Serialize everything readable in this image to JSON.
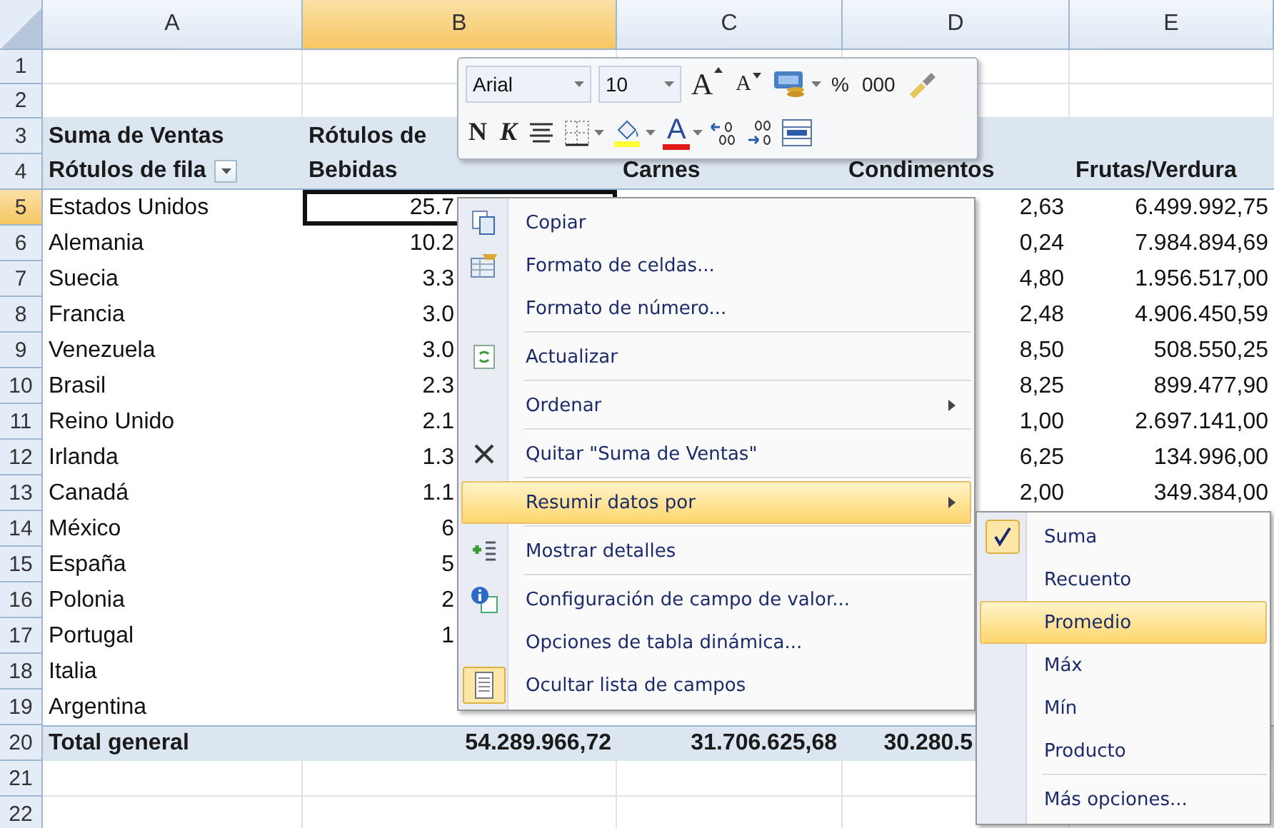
{
  "columns": [
    {
      "label": "A",
      "selected": false
    },
    {
      "label": "B",
      "selected": true
    },
    {
      "label": "C",
      "selected": false
    },
    {
      "label": "D",
      "selected": false
    },
    {
      "label": "E",
      "selected": false
    }
  ],
  "rows": [
    {
      "number": "1",
      "kind": "blank",
      "selected": false
    },
    {
      "number": "2",
      "kind": "blank",
      "selected": false
    },
    {
      "number": "3",
      "kind": "title",
      "selected": false,
      "a": "Suma de Ventas",
      "b": "Rótulos de"
    },
    {
      "number": "4",
      "kind": "labels",
      "selected": false,
      "a": "Rótulos de fila",
      "b": "Bebidas",
      "c": "Carnes",
      "d": "Condimentos",
      "e": "Frutas/Verdura"
    },
    {
      "number": "5",
      "kind": "data",
      "selected": true,
      "a": "Estados Unidos",
      "b": "25.7",
      "d": "2,63",
      "e": "6.499.992,75"
    },
    {
      "number": "6",
      "kind": "data",
      "selected": false,
      "a": "Alemania",
      "b": "10.2",
      "d": "0,24",
      "e": "7.984.894,69"
    },
    {
      "number": "7",
      "kind": "data",
      "selected": false,
      "a": "Suecia",
      "b": "3.3",
      "d": "4,80",
      "e": "1.956.517,00"
    },
    {
      "number": "8",
      "kind": "data",
      "selected": false,
      "a": "Francia",
      "b": "3.0",
      "d": "2,48",
      "e": "4.906.450,59"
    },
    {
      "number": "9",
      "kind": "data",
      "selected": false,
      "a": "Venezuela",
      "b": "3.0",
      "d": "8,50",
      "e": "508.550,25"
    },
    {
      "number": "10",
      "kind": "data",
      "selected": false,
      "a": "Brasil",
      "b": "2.3",
      "d": "8,25",
      "e": "899.477,90"
    },
    {
      "number": "11",
      "kind": "data",
      "selected": false,
      "a": "Reino Unido",
      "b": "2.1",
      "d": "1,00",
      "e": "2.697.141,00"
    },
    {
      "number": "12",
      "kind": "data",
      "selected": false,
      "a": "Irlanda",
      "b": "1.3",
      "d": "6,25",
      "e": "134.996,00"
    },
    {
      "number": "13",
      "kind": "data",
      "selected": false,
      "a": "Canadá",
      "b": "1.1",
      "d": "2,00",
      "e": "349.384,00"
    },
    {
      "number": "14",
      "kind": "data",
      "selected": false,
      "a": "México",
      "b": "6"
    },
    {
      "number": "15",
      "kind": "data",
      "selected": false,
      "a": "España",
      "b": "5"
    },
    {
      "number": "16",
      "kind": "data",
      "selected": false,
      "a": "Polonia",
      "b": "2"
    },
    {
      "number": "17",
      "kind": "data",
      "selected": false,
      "a": "Portugal",
      "b": "1"
    },
    {
      "number": "18",
      "kind": "data",
      "selected": false,
      "a": "Italia"
    },
    {
      "number": "19",
      "kind": "data",
      "selected": false,
      "a": "Argentina"
    },
    {
      "number": "20",
      "kind": "total",
      "selected": false,
      "a": "Total general",
      "b": "54.289.966,72",
      "c": "31.706.625,68",
      "d": "30.280.5"
    },
    {
      "number": "21",
      "kind": "blank",
      "selected": false
    },
    {
      "number": "22",
      "kind": "blank",
      "selected": false
    }
  ],
  "mini_toolbar": {
    "font": "Arial",
    "size": "10",
    "row1": [
      {
        "kind": "grow",
        "label": "A"
      },
      {
        "kind": "shrink",
        "label": "A"
      },
      {
        "kind": "accounting"
      },
      {
        "kind": "text",
        "label": "%"
      },
      {
        "kind": "text",
        "label": "000"
      },
      {
        "kind": "painter"
      }
    ],
    "row2": [
      {
        "kind": "bold",
        "label": "N"
      },
      {
        "kind": "italic",
        "label": "K"
      },
      {
        "kind": "center"
      },
      {
        "kind": "borders"
      },
      {
        "kind": "fill"
      },
      {
        "kind": "fontcolor",
        "label": "A"
      },
      {
        "kind": "incdec"
      },
      {
        "kind": "decdec"
      },
      {
        "kind": "merge"
      }
    ]
  },
  "context_menu": [
    {
      "label": "Copiar",
      "kind": "copy",
      "submenu": false,
      "selected": false,
      "checked": false,
      "separator_after": false
    },
    {
      "label": "Formato de celdas...",
      "kind": "format",
      "submenu": false,
      "selected": false,
      "checked": false,
      "separator_after": false
    },
    {
      "label": "Formato de número...",
      "kind": "plain",
      "submenu": false,
      "selected": false,
      "checked": false,
      "separator_after": true
    },
    {
      "label": "Actualizar",
      "kind": "refresh",
      "submenu": false,
      "selected": false,
      "checked": false,
      "separator_after": true
    },
    {
      "label": "Ordenar",
      "kind": "plain",
      "submenu": true,
      "selected": false,
      "checked": false,
      "separator_after": true
    },
    {
      "label": "Quitar \"Suma de Ventas\"",
      "kind": "remove",
      "submenu": false,
      "selected": false,
      "checked": false,
      "separator_after": true
    },
    {
      "label": "Resumir datos por",
      "kind": "plain",
      "submenu": true,
      "selected": true,
      "checked": false,
      "separator_after": true
    },
    {
      "label": "Mostrar detalles",
      "kind": "details",
      "submenu": false,
      "selected": false,
      "checked": false,
      "separator_after": true
    },
    {
      "label": "Configuración de campo de valor...",
      "kind": "info",
      "submenu": false,
      "selected": false,
      "checked": false,
      "separator_after": false
    },
    {
      "label": "Opciones de tabla dinámica...",
      "kind": "plain",
      "submenu": false,
      "selected": false,
      "checked": false,
      "separator_after": false
    },
    {
      "label": "Ocultar lista de campos",
      "kind": "fieldlist",
      "submenu": false,
      "selected": false,
      "checked": true,
      "separator_after": false
    }
  ],
  "submenu": [
    {
      "label": "Suma",
      "checked": true,
      "selected": false,
      "separator_after": false
    },
    {
      "label": "Recuento",
      "checked": false,
      "selected": false,
      "separator_after": false
    },
    {
      "label": "Promedio",
      "checked": false,
      "selected": true,
      "separator_after": false
    },
    {
      "label": "Máx",
      "checked": false,
      "selected": false,
      "separator_after": false
    },
    {
      "label": "Mín",
      "checked": false,
      "selected": false,
      "separator_after": false
    },
    {
      "label": "Producto",
      "checked": false,
      "selected": false,
      "separator_after": true
    },
    {
      "label": "Más opciones...",
      "checked": false,
      "selected": false,
      "separator_after": false
    }
  ]
}
